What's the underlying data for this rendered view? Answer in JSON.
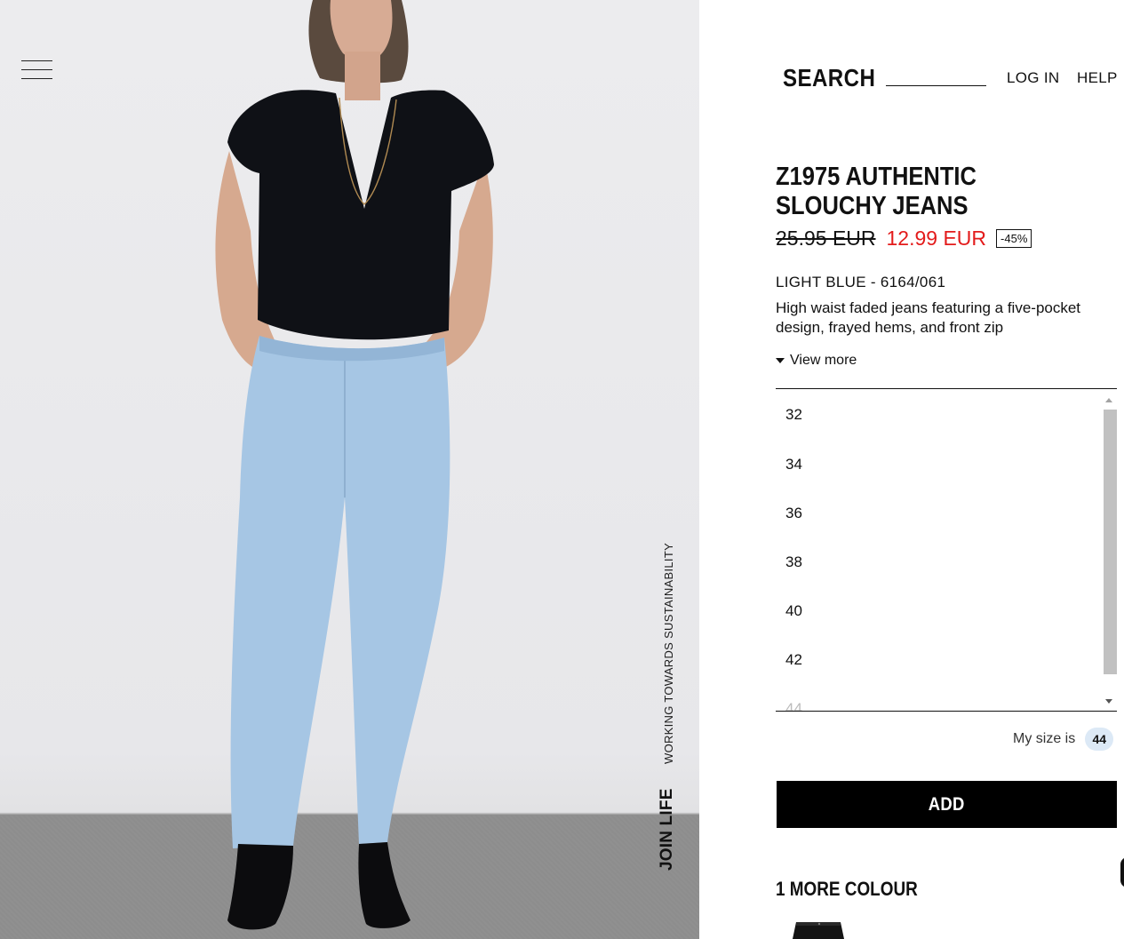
{
  "header": {
    "search_label": "SEARCH",
    "search_placeholder": "",
    "login_label": "LOG IN",
    "help_label": "HELP"
  },
  "hero": {
    "sustainability_label": "WORKING TOWARDS SUSTAINABILITY",
    "joinlife_label": "JOIN LIFE"
  },
  "product": {
    "title": "Z1975 AUTHENTIC SLOUCHY JEANS",
    "old_price": "25.95 EUR",
    "new_price": "12.99 EUR",
    "discount": "-45%",
    "color_ref": "LIGHT BLUE - 6164/061",
    "description": "High waist faded jeans featuring a five-pocket design, frayed hems, and front zip",
    "view_more": "View more"
  },
  "sizes": [
    "32",
    "34",
    "36",
    "38",
    "40",
    "42",
    "44"
  ],
  "my_size": {
    "label": "My size is",
    "value": "44"
  },
  "add_label": "ADD",
  "more_colours_label": "1 MORE COLOUR",
  "colors": {
    "sale_red": "#e31b1b",
    "badge_blue": "#dce9f6",
    "button_black": "#000000"
  }
}
